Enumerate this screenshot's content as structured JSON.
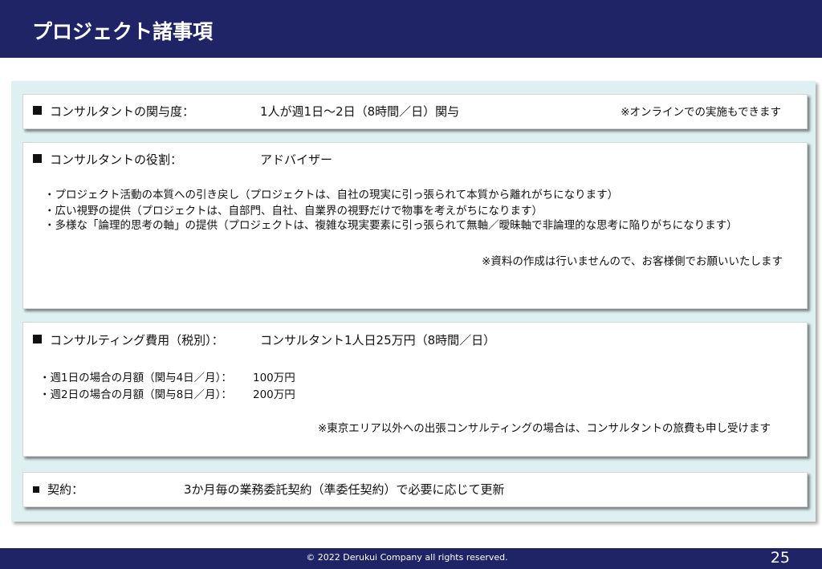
{
  "header": {
    "title": "プロジェクト諸事項"
  },
  "involvement": {
    "label": "コンサルタントの関与度：",
    "value": "1人が週1日～2日（8時間／日）関与",
    "note": "※オンラインでの実施もできます"
  },
  "role": {
    "label": "コンサルタントの役割：",
    "value": "アドバイザー",
    "bullets": [
      "・プロジェクト活動の本質への引き戻し（プロジェクトは、自社の現実に引っ張られて本質から離れがちになります）",
      "・広い視野の提供（プロジェクトは、自部門、自社、自業界の視野だけで物事を考えがちになります）",
      "・多様な「論理的思考の軸」の提供（プロジェクトは、複雑な現実要素に引っ張られて無軸／曖昧軸で非論理的な思考に陥りがちになります）"
    ],
    "note": "※資料の作成は行いませんので、お客様側でお願いいたします"
  },
  "fee": {
    "label": "コンサルティング費用（税別）：",
    "value": "コンサルタント1人日25万円（8時間／日）",
    "lines": [
      {
        "label": "・週1日の場合の月額（関与4日／月）：",
        "amount": "100万円"
      },
      {
        "label": "・週2日の場合の月額（関与8日／月）：",
        "amount": "200万円"
      }
    ],
    "note": "※東京エリア以外への出張コンサルティングの場合は、コンサルタントの旅費も申し受けます"
  },
  "contract": {
    "label": "契約：",
    "value": "3か月毎の業務委託契約（準委任契約）で必要に応じて更新"
  },
  "footer": {
    "copyright": "© 2022 Derukui Company all rights reserved.",
    "page_number": "25"
  }
}
